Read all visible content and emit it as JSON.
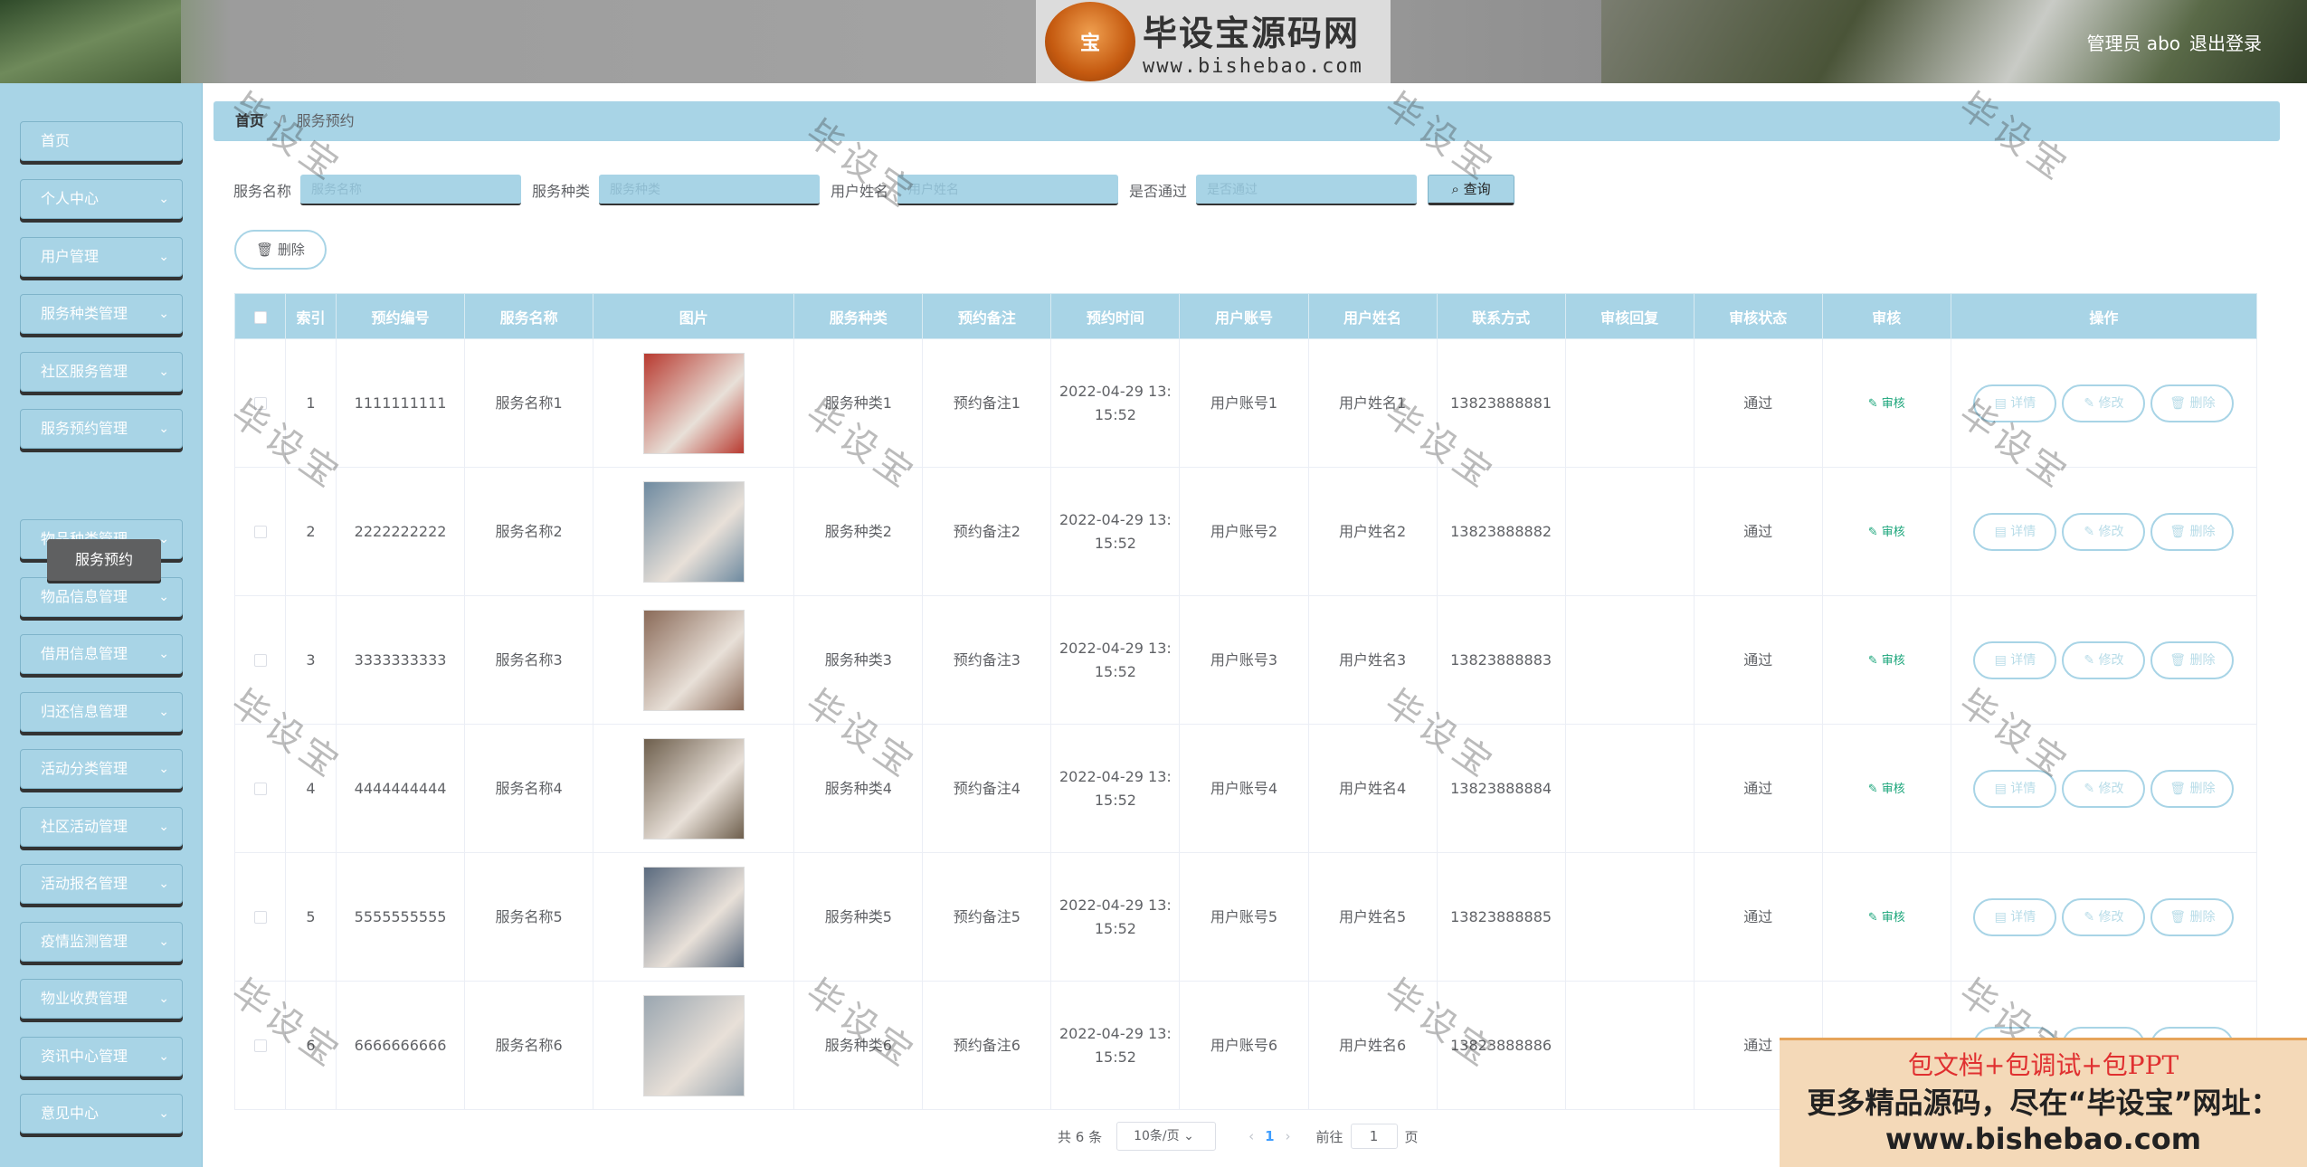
{
  "header": {
    "logo_cn": "毕设宝源码网",
    "logo_url": "www.bishebao.com",
    "user_label": "管理员 abo",
    "logout_label": "退出登录"
  },
  "sidebar": {
    "items": [
      {
        "label": "首页",
        "has_chevron": false
      },
      {
        "label": "个人中心",
        "has_chevron": true
      },
      {
        "label": "用户管理",
        "has_chevron": true
      },
      {
        "label": "服务种类管理",
        "has_chevron": true
      },
      {
        "label": "社区服务管理",
        "has_chevron": true
      },
      {
        "label": "服务预约管理",
        "has_chevron": true
      },
      {
        "label": "物品种类管理",
        "has_chevron": true
      },
      {
        "label": "物品信息管理",
        "has_chevron": true
      },
      {
        "label": "借用信息管理",
        "has_chevron": true
      },
      {
        "label": "归还信息管理",
        "has_chevron": true
      },
      {
        "label": "活动分类管理",
        "has_chevron": true
      },
      {
        "label": "社区活动管理",
        "has_chevron": true
      },
      {
        "label": "活动报名管理",
        "has_chevron": true
      },
      {
        "label": "疫情监测管理",
        "has_chevron": true
      },
      {
        "label": "物业收费管理",
        "has_chevron": true
      },
      {
        "label": "资讯中心管理",
        "has_chevron": true
      },
      {
        "label": "意见中心",
        "has_chevron": true
      }
    ],
    "active_sub": "服务预约"
  },
  "breadcrumb": {
    "home": "首页",
    "current": "服务预约"
  },
  "search": {
    "service_name_label": "服务名称",
    "service_name_placeholder": "服务名称",
    "service_type_label": "服务种类",
    "service_type_placeholder": "服务种类",
    "user_name_label": "用户姓名",
    "user_name_placeholder": "用户姓名",
    "approved_label": "是否通过",
    "approved_placeholder": "是否通过",
    "query_label": "查询"
  },
  "toolbar": {
    "delete_label": "删除"
  },
  "table": {
    "headers": [
      "",
      "索引",
      "预约编号",
      "服务名称",
      "图片",
      "服务种类",
      "预约备注",
      "预约时间",
      "用户账号",
      "用户姓名",
      "联系方式",
      "审核回复",
      "审核状态",
      "审核",
      "操作"
    ],
    "rows": [
      {
        "index": "1",
        "code": "1111111111",
        "name": "服务名称1",
        "type": "服务种类1",
        "remark": "预约备注1",
        "time1": "2022-04-29 13:",
        "time2": "15:52",
        "account": "用户账号1",
        "user": "用户姓名1",
        "phone": "13823888881",
        "reply": "",
        "status": "通过",
        "img": "#b83a30"
      },
      {
        "index": "2",
        "code": "2222222222",
        "name": "服务名称2",
        "type": "服务种类2",
        "remark": "预约备注2",
        "time1": "2022-04-29 13:",
        "time2": "15:52",
        "account": "用户账号2",
        "user": "用户姓名2",
        "phone": "13823888882",
        "reply": "",
        "status": "通过",
        "img": "#6e8aa0"
      },
      {
        "index": "3",
        "code": "3333333333",
        "name": "服务名称3",
        "type": "服务种类3",
        "remark": "预约备注3",
        "time1": "2022-04-29 13:",
        "time2": "15:52",
        "account": "用户账号3",
        "user": "用户姓名3",
        "phone": "13823888883",
        "reply": "",
        "status": "通过",
        "img": "#8a6a58"
      },
      {
        "index": "4",
        "code": "4444444444",
        "name": "服务名称4",
        "type": "服务种类4",
        "remark": "预约备注4",
        "time1": "2022-04-29 13:",
        "time2": "15:52",
        "account": "用户账号4",
        "user": "用户姓名4",
        "phone": "13823888884",
        "reply": "",
        "status": "通过",
        "img": "#6d5e4c"
      },
      {
        "index": "5",
        "code": "5555555555",
        "name": "服务名称5",
        "type": "服务种类5",
        "remark": "预约备注5",
        "time1": "2022-04-29 13:",
        "time2": "15:52",
        "account": "用户账号5",
        "user": "用户姓名5",
        "phone": "13823888885",
        "reply": "",
        "status": "通过",
        "img": "#5a6a7e"
      },
      {
        "index": "6",
        "code": "6666666666",
        "name": "服务名称6",
        "type": "服务种类6",
        "remark": "预约备注6",
        "time1": "2022-04-29 13:",
        "time2": "15:52",
        "account": "用户账号6",
        "user": "用户姓名6",
        "phone": "13823888886",
        "reply": "",
        "status": "通过",
        "img": "#9aa6b0"
      }
    ],
    "audit_label": "审核",
    "detail_label": "详情",
    "edit_label": "修改",
    "delete_label": "删除"
  },
  "pagination": {
    "total": "共 6 条",
    "page_size": "10条/页",
    "current_page": "1",
    "goto_label": "前往",
    "goto_value": "1",
    "page_unit": "页"
  },
  "watermark": "毕设宝",
  "ad": {
    "line1": "包文档+包调试+包PPT",
    "line2": "更多精品源码，尽在“毕设宝”网址：",
    "line3": "www.bishebao.com"
  }
}
